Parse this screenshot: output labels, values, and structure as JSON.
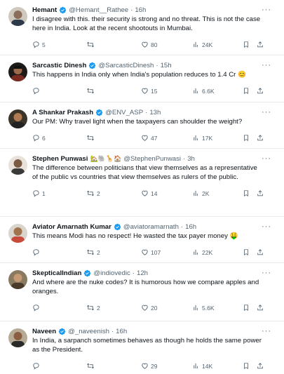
{
  "tweets": [
    {
      "name": "Hemant",
      "handle": "@Hemant__Rathee",
      "time": "16h",
      "emoji": "",
      "text": "I disagree with this. their security is strong and no threat. This is not the case here in India. Look at the recent shootouts in Mumbai.",
      "replies": "5",
      "retweets": "",
      "likes": "80",
      "views": "24K",
      "avatar_color": "#b8b2a8"
    },
    {
      "name": "Sarcastic Dinesh",
      "handle": "@SarcasticDinesh",
      "time": "15h",
      "emoji": "",
      "text": "This happens in India only when India's population reduces to 1.4 Cr 😊",
      "replies": "",
      "retweets": "",
      "likes": "15",
      "views": "6.6K",
      "avatar_color": "#3a2a22"
    },
    {
      "name": "A Shankar Prakash",
      "handle": "@ENV_ASP",
      "time": "13h",
      "emoji": "",
      "text": "Our PM: Why travel light when the taxpayers can shoulder the weight?",
      "replies": "6",
      "retweets": "",
      "likes": "47",
      "views": "17K",
      "avatar_color": "#4d4538"
    },
    {
      "name": "Stephen Punwasi",
      "handle": "@StephenPunwasi",
      "time": "3h",
      "emoji": "🏡🐘🦒🏠",
      "text": "The difference between politicians that view themselves as a representative of the public vs countries that view themselves as rulers of the public.",
      "replies": "1",
      "retweets": "2",
      "likes": "14",
      "views": "2K",
      "avatar_color": "#6a5a4c"
    },
    {
      "name": "Aviator Amarnath Kumar",
      "handle": "@aviatoramarnath",
      "time": "16h",
      "emoji": "",
      "text": "This means Modi has no respect! He wasted the tax payer money 🤑",
      "replies": "",
      "retweets": "2",
      "likes": "107",
      "views": "22K",
      "avatar_color": "#c84a3a"
    },
    {
      "name": "SkepticalIndian",
      "handle": "@indiovedic",
      "time": "12h",
      "emoji": "",
      "text": "And where are the nuke codes? It is humorous how we compare apples and oranges.",
      "replies": "",
      "retweets": "2",
      "likes": "20",
      "views": "5.6K",
      "avatar_color": "#6b5a45"
    },
    {
      "name": "Naveen",
      "handle": "@_naveenish",
      "time": "16h",
      "emoji": "",
      "text": "In India, a sarpanch sometimes behaves as though he holds the same power as the President.",
      "replies": "",
      "retweets": "",
      "likes": "29",
      "views": "14K",
      "avatar_color": "#5a4a3c"
    }
  ],
  "colors": {
    "verified": "#1d9bf0",
    "muted": "#536471",
    "divider": "#e6ecf0"
  },
  "icons": {
    "reply": "reply-icon",
    "retweet": "retweet-icon",
    "like": "heart-icon",
    "views": "views-chart-icon",
    "bookmark": "bookmark-icon",
    "share": "share-icon",
    "more": "more-dots-icon",
    "verified": "verified-badge-icon"
  }
}
